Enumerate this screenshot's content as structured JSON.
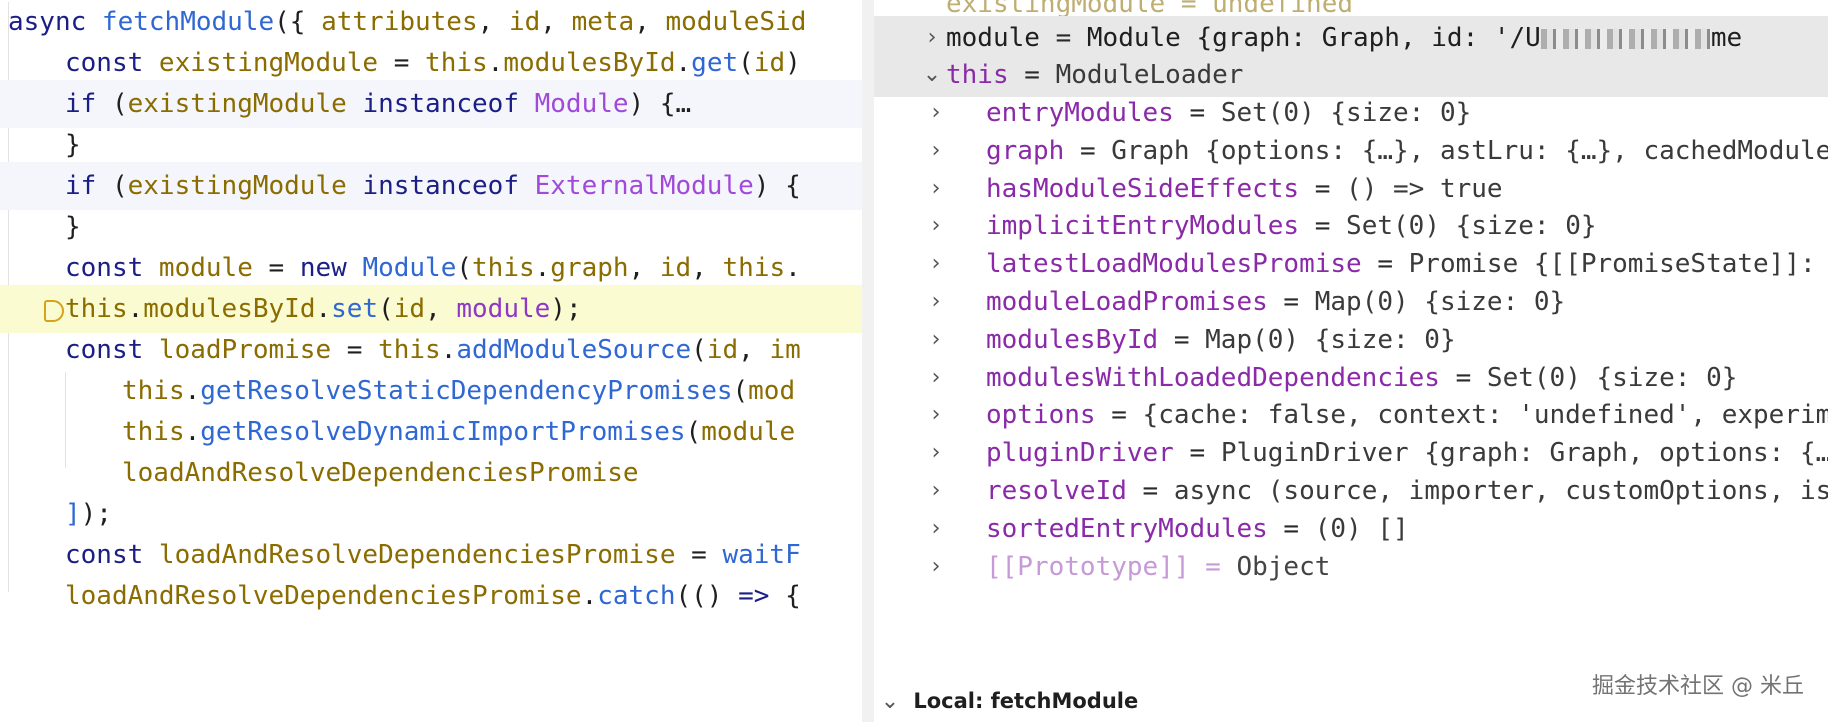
{
  "editor": {
    "lines": [
      {
        "tokens": [
          [
            "kw",
            "async "
          ],
          [
            "fn",
            "fetchModule"
          ],
          [
            "pun",
            "({ "
          ],
          [
            "var",
            "attributes"
          ],
          [
            "pun",
            ", "
          ],
          [
            "var",
            "id"
          ],
          [
            "pun",
            ", "
          ],
          [
            "var",
            "meta"
          ],
          [
            "pun",
            ", "
          ],
          [
            "var",
            "moduleSid"
          ]
        ]
      },
      {
        "tokens": [
          [
            "kw",
            "const "
          ],
          [
            "var",
            "existingModule"
          ],
          [
            "pun",
            " = "
          ],
          [
            "var",
            "this"
          ],
          [
            "pun",
            "."
          ],
          [
            "var",
            "modulesById"
          ],
          [
            "pun",
            "."
          ],
          [
            "fn",
            "get"
          ],
          [
            "pun",
            "("
          ],
          [
            "var",
            "id"
          ],
          [
            "pun",
            ")"
          ]
        ]
      },
      {
        "tokens": [
          [
            "kw",
            "if "
          ],
          [
            "pun",
            "("
          ],
          [
            "var",
            "existingModule"
          ],
          [
            "pun",
            " "
          ],
          [
            "kw",
            "instanceof "
          ],
          [
            "cls",
            "Module"
          ],
          [
            "pun",
            ") {…"
          ]
        ]
      },
      {
        "tokens": [
          [
            "pun",
            "}"
          ]
        ]
      },
      {
        "tokens": [
          [
            "kw",
            "if "
          ],
          [
            "pun",
            "("
          ],
          [
            "var",
            "existingModule"
          ],
          [
            "pun",
            " "
          ],
          [
            "kw",
            "instanceof "
          ],
          [
            "cls",
            "ExternalModule"
          ],
          [
            "pun",
            ") {"
          ]
        ]
      },
      {
        "tokens": [
          [
            "pun",
            "}"
          ]
        ]
      },
      {
        "tokens": [
          [
            "kw",
            "const "
          ],
          [
            "var",
            "module"
          ],
          [
            "pun",
            " = "
          ],
          [
            "kw",
            "new "
          ],
          [
            "fn",
            "Module"
          ],
          [
            "pun",
            "("
          ],
          [
            "var",
            "this"
          ],
          [
            "pun",
            "."
          ],
          [
            "var",
            "graph"
          ],
          [
            "pun",
            ", "
          ],
          [
            "var",
            "id"
          ],
          [
            "pun",
            ", "
          ],
          [
            "var",
            "this"
          ],
          [
            "pun",
            "."
          ]
        ]
      },
      {
        "tokens": [
          [
            "var",
            "this"
          ],
          [
            "pun",
            "."
          ],
          [
            "var",
            "modulesById"
          ],
          [
            "pun",
            "."
          ],
          [
            "fn",
            "set"
          ],
          [
            "pun",
            "("
          ],
          [
            "var",
            "id"
          ],
          [
            "pun",
            ", "
          ],
          [
            "mod",
            "module"
          ],
          [
            "pun",
            ");"
          ]
        ]
      },
      {
        "tokens": [
          [
            "kw",
            "const "
          ],
          [
            "var",
            "loadPromise"
          ],
          [
            "pun",
            " = "
          ],
          [
            "var",
            "this"
          ],
          [
            "pun",
            "."
          ],
          [
            "fn",
            "addModuleSource"
          ],
          [
            "pun",
            "("
          ],
          [
            "var",
            "id"
          ],
          [
            "pun",
            ", "
          ],
          [
            "var",
            "im"
          ]
        ]
      },
      {
        "tokens": [
          [
            "var",
            "this"
          ],
          [
            "pun",
            "."
          ],
          [
            "fn",
            "getResolveStaticDependencyPromises"
          ],
          [
            "pun",
            "("
          ],
          [
            "var",
            "mod"
          ]
        ]
      },
      {
        "tokens": [
          [
            "var",
            "this"
          ],
          [
            "pun",
            "."
          ],
          [
            "fn",
            "getResolveDynamicImportPromises"
          ],
          [
            "pun",
            "("
          ],
          [
            "var",
            "module"
          ]
        ]
      },
      {
        "tokens": [
          [
            "var",
            "loadAndResolveDependenciesPromise"
          ]
        ]
      },
      {
        "tokens": [
          [
            "fn",
            "]"
          ],
          [
            "pun",
            ");"
          ]
        ]
      },
      {
        "tokens": [
          [
            "kw",
            "const "
          ],
          [
            "var",
            "loadAndResolveDependenciesPromise"
          ],
          [
            "pun",
            " = "
          ],
          [
            "fn",
            "waitF"
          ]
        ]
      },
      {
        "tokens": [
          [
            "var",
            "loadAndResolveDependenciesPromise"
          ],
          [
            "pun",
            "."
          ],
          [
            "fn",
            "catch"
          ],
          [
            "pun",
            "(() "
          ],
          [
            "kw",
            "=>"
          ],
          [
            "pun",
            " {"
          ]
        ]
      }
    ]
  },
  "debugger": {
    "top_partial": {
      "name": "existingModule",
      "value": "= undefined"
    },
    "module_row": {
      "name": "module",
      "value": "Module {graph: Graph, id: '/U",
      "tail": "me"
    },
    "this_row": {
      "name": "this",
      "value": "ModuleLoader"
    },
    "children": [
      {
        "name": "entryModules",
        "value": "Set(0) {size: 0}"
      },
      {
        "name": "graph",
        "value": "Graph {options: {…}, astLru: {…}, cachedModules"
      },
      {
        "name": "hasModuleSideEffects",
        "value": "() => true"
      },
      {
        "name": "implicitEntryModules",
        "value": "Set(0) {size: 0}"
      },
      {
        "name": "latestLoadModulesPromise",
        "value": "Promise {[[PromiseState]]:"
      },
      {
        "name": "moduleLoadPromises",
        "value": "Map(0) {size: 0}"
      },
      {
        "name": "modulesById",
        "value": "Map(0) {size: 0}",
        "highlighted": true
      },
      {
        "name": "modulesWithLoadedDependencies",
        "value": "Set(0) {size: 0}"
      },
      {
        "name": "options",
        "value": "{cache: false, context: 'undefined', experime"
      },
      {
        "name": "pluginDriver",
        "value": "PluginDriver {graph: Graph, options: {…"
      },
      {
        "name": "resolveId",
        "value": "async (source, importer, customOptions, isE"
      },
      {
        "name": "sortedEntryModules",
        "value": "(0) []"
      },
      {
        "name": "[[Prototype]]",
        "value": "Object",
        "proto": true
      }
    ],
    "local_header": "Local: fetchModule",
    "chevrons": {
      "collapsed": "›",
      "expanded": "⌄"
    },
    "equals": "="
  },
  "watermark": "掘金技术社区 @ 米丘",
  "colors": {
    "keyword": "#1b1f85",
    "function": "#2f67d3",
    "variable": "#8a6c00",
    "class": "#a14ad9",
    "breakpoint_line": "#fbfbd2",
    "highlight_mark": "#fcd3e4",
    "var_name": "#8a2aa8"
  }
}
